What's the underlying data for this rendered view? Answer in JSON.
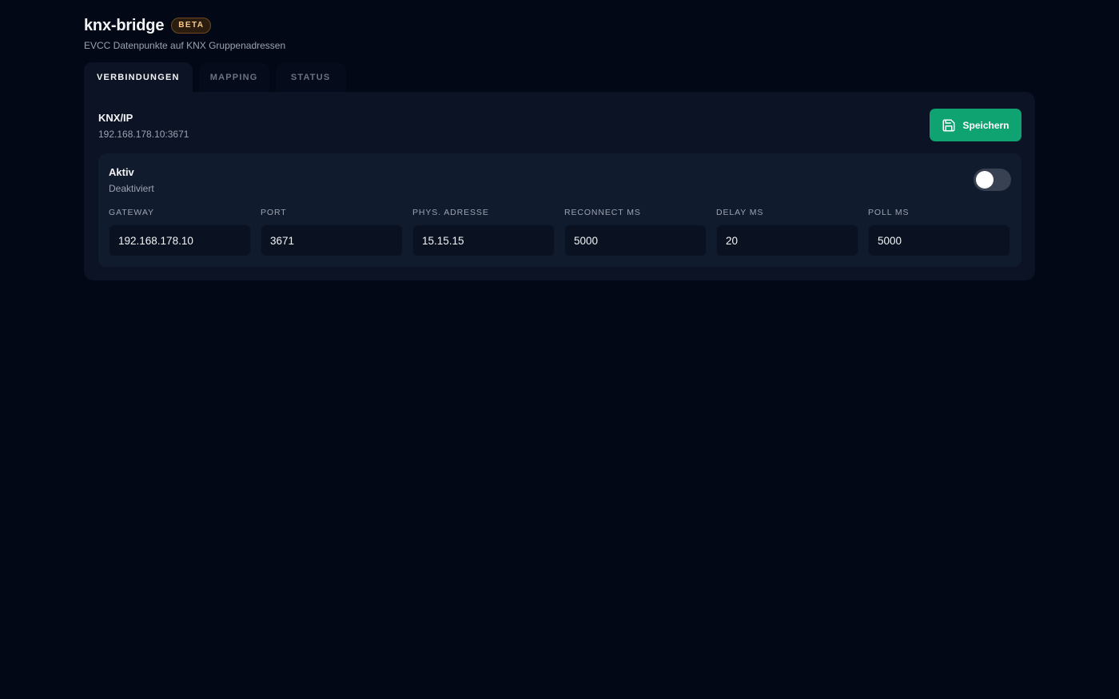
{
  "header": {
    "title": "knx-bridge",
    "badge": "BETA",
    "subtitle": "EVCC Datenpunkte auf KNX Gruppenadressen"
  },
  "tabs": [
    {
      "label": "VERBINDUNGEN",
      "active": true
    },
    {
      "label": "MAPPING",
      "active": false
    },
    {
      "label": "STATUS",
      "active": false
    }
  ],
  "connection": {
    "title": "KNX/IP",
    "address": "192.168.178.10:3671",
    "save_label": "Speichern",
    "save_icon": "save-icon",
    "accent_color": "#0ea370"
  },
  "active_section": {
    "title": "Aktiv",
    "status": "Deaktiviert",
    "toggle_on": false
  },
  "fields": [
    {
      "label": "GATEWAY",
      "value": "192.168.178.10"
    },
    {
      "label": "PORT",
      "value": "3671"
    },
    {
      "label": "PHYS. ADRESSE",
      "value": "15.15.15"
    },
    {
      "label": "RECONNECT MS",
      "value": "5000"
    },
    {
      "label": "DELAY MS",
      "value": "20"
    },
    {
      "label": "POLL MS",
      "value": "5000"
    }
  ]
}
